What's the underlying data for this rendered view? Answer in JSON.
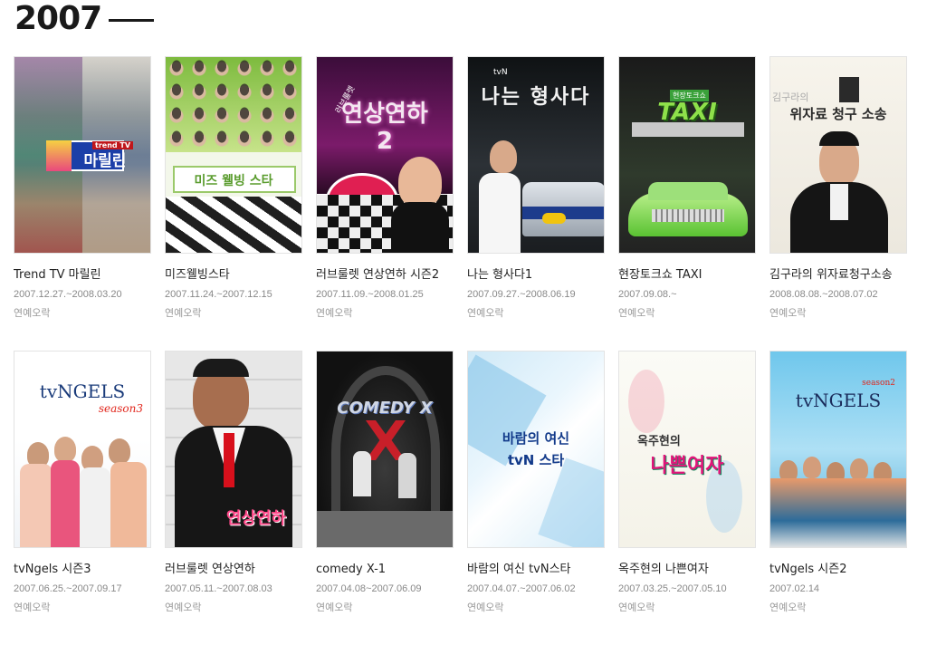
{
  "header": {
    "year": "2007"
  },
  "programs": [
    {
      "title": "Trend TV 마릴린",
      "dates": "2007.12.27.~2008.03.20",
      "genre": "연예오락",
      "poster_text": "마릴린",
      "poster_sub": "trend TV"
    },
    {
      "title": "미즈웰빙스타",
      "dates": "2007.11.24.~2007.12.15",
      "genre": "연예오락",
      "poster_text": "미즈 웰빙 스타",
      "poster_sub": ""
    },
    {
      "title": "러브룰렛 연상연하 시즌2",
      "dates": "2007.11.09.~2008.01.25",
      "genre": "연예오락",
      "poster_text": "연상연하2",
      "poster_sub": "러브룰렛"
    },
    {
      "title": "나는 형사다1",
      "dates": "2007.09.27.~2008.06.19",
      "genre": "연예오락",
      "poster_text": "나는 형사다",
      "poster_sub": "tvN"
    },
    {
      "title": "현장토크쇼 TAXI",
      "dates": "2007.09.08.~",
      "genre": "연예오락",
      "poster_text": "TAXI",
      "poster_sub": "현장토크쇼"
    },
    {
      "title": "김구라의 위자료청구소송",
      "dates": "2008.08.08.~2008.07.02",
      "genre": "연예오락",
      "poster_text": "위자료 청구 소송",
      "poster_sub": "김구라의"
    },
    {
      "title": "tvNgels 시즌3",
      "dates": "2007.06.25.~2007.09.17",
      "genre": "연예오락",
      "poster_text": "tvNGELS",
      "poster_sub": "season3"
    },
    {
      "title": "러브룰렛 연상연하",
      "dates": "2007.05.11.~2007.08.03",
      "genre": "연예오락",
      "poster_text": "연상연하",
      "poster_sub": ""
    },
    {
      "title": "comedy X-1",
      "dates": "2007.04.08~2007.06.09",
      "genre": "연예오락",
      "poster_text": "COMEDY X",
      "poster_sub": ""
    },
    {
      "title": "바람의 여신 tvN스타",
      "dates": "2007.04.07.~2007.06.02",
      "genre": "연예오락",
      "poster_text": "바람의 여신 tvN 스타",
      "poster_sub": ""
    },
    {
      "title": "옥주현의 나쁜여자",
      "dates": "2007.03.25.~2007.05.10",
      "genre": "연예오락",
      "poster_text": "나쁜여자",
      "poster_sub": "옥주현의"
    },
    {
      "title": "tvNgels 시즌2",
      "dates": "2007.02.14",
      "genre": "연예오락",
      "poster_text": "tvNGELS",
      "poster_sub": "season2"
    }
  ]
}
